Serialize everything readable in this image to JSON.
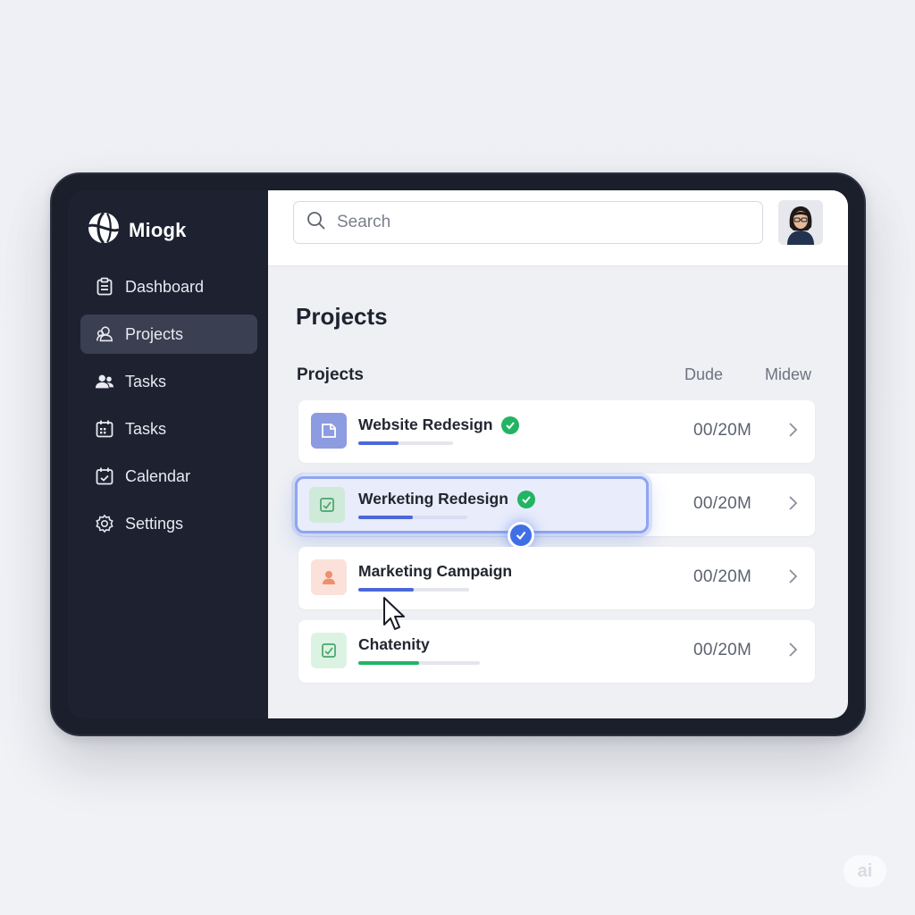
{
  "brand": {
    "name": "Miogk"
  },
  "sidebar": {
    "items": [
      {
        "label": "Dashboard",
        "icon": "clipboard-icon",
        "active": false
      },
      {
        "label": "Projects",
        "icon": "people-outline-icon",
        "active": true
      },
      {
        "label": "Tasks",
        "icon": "users-icon",
        "active": false
      },
      {
        "label": "Tasks",
        "icon": "calendar-grid-icon",
        "active": false
      },
      {
        "label": "Calendar",
        "icon": "calendar-check-icon",
        "active": false
      },
      {
        "label": "Settings",
        "icon": "gear-icon",
        "active": false
      }
    ]
  },
  "search": {
    "placeholder": "Search",
    "value": ""
  },
  "main": {
    "title": "Projects",
    "list_header": {
      "title": "Projects",
      "col1": "Dude",
      "col2": "Midew"
    },
    "rows": [
      {
        "name": "Website Redesign",
        "value": "00/20M",
        "checked": true,
        "icon": "document-icon",
        "icon_bg": "#8d9be0",
        "bar_color": "#4b67d8",
        "progress": 0.42
      },
      {
        "name": "Werketing Redesign",
        "value": "00/20M",
        "checked": true,
        "icon": "chart-check-icon",
        "icon_bg": "#cfead9",
        "bar_color": "#4b67d8",
        "progress": 0.5
      },
      {
        "name": "Marketing Campaign",
        "value": "00/20M",
        "checked": false,
        "icon": "person-icon",
        "icon_bg": "#fbe1d9",
        "bar_color": "#4b67d8",
        "progress": 0.5
      },
      {
        "name": "Chatenity",
        "value": "00/20M",
        "checked": false,
        "icon": "chart-check-icon",
        "icon_bg": "#dcf3e3",
        "bar_color": "#22b463",
        "progress": 0.5
      }
    ]
  },
  "colors": {
    "sidebar_bg": "#1d2130",
    "accent": "#3f6fe6",
    "success": "#22b463"
  },
  "watermark": "ai"
}
